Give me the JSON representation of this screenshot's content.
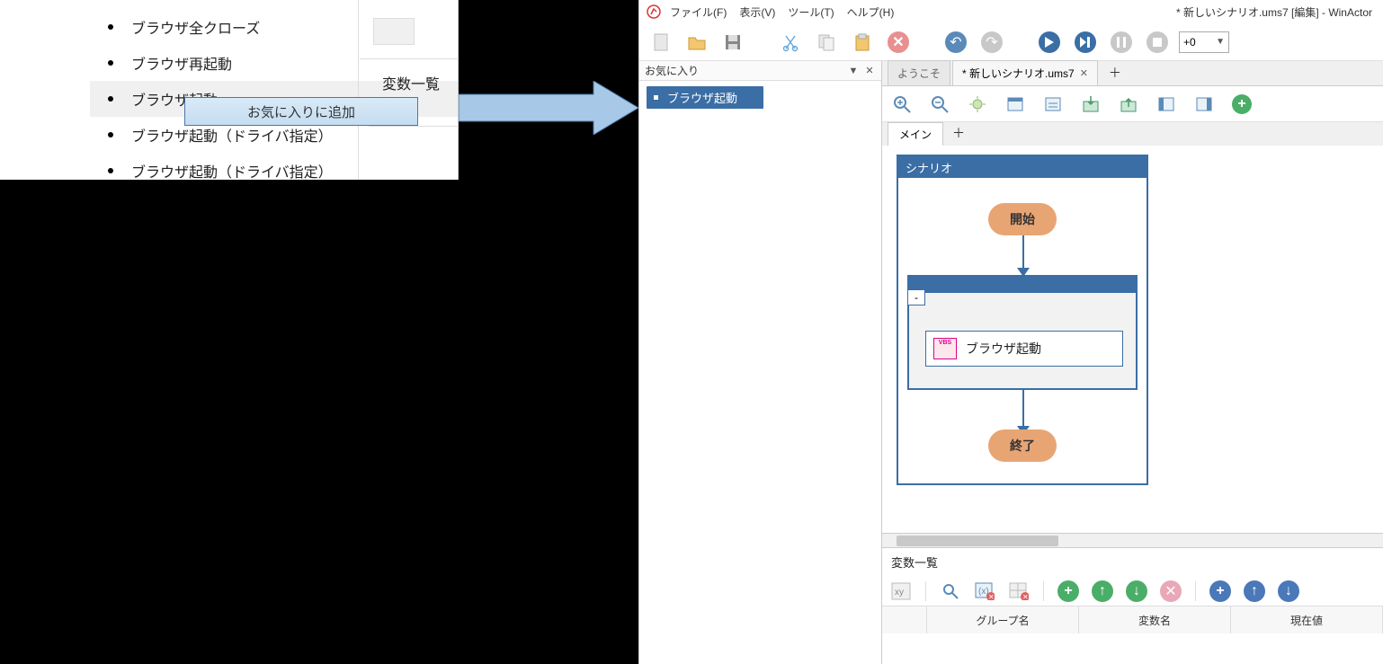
{
  "left": {
    "items": [
      "ブラウザ全クローズ",
      "ブラウザ再起動",
      "ブラウザ起動",
      "ブラウザ起動（ドライバ指定）",
      "ブラウザ起動（ドライバ指定）"
    ],
    "context_menu": "お気に入りに追加",
    "variable_label": "変数一覧"
  },
  "app": {
    "menus": [
      "ファイル(F)",
      "表示(V)",
      "ツール(T)",
      "ヘルプ(H)"
    ],
    "title": "* 新しいシナリオ.ums7 [編集] - WinActor",
    "speed_value": "+0"
  },
  "fav": {
    "header": "お気に入り",
    "item": "ブラウザ起動"
  },
  "tabs": {
    "welcome": "ようこそ",
    "file": "* 新しいシナリオ.ums7",
    "inner": "メイン"
  },
  "scenario": {
    "title": "シナリオ",
    "start": "開始",
    "end": "終了",
    "action": "ブラウザ起動",
    "group_handle": "-"
  },
  "vars": {
    "title": "変数一覧",
    "cols": [
      "グループ名",
      "変数名",
      "現在値"
    ]
  }
}
